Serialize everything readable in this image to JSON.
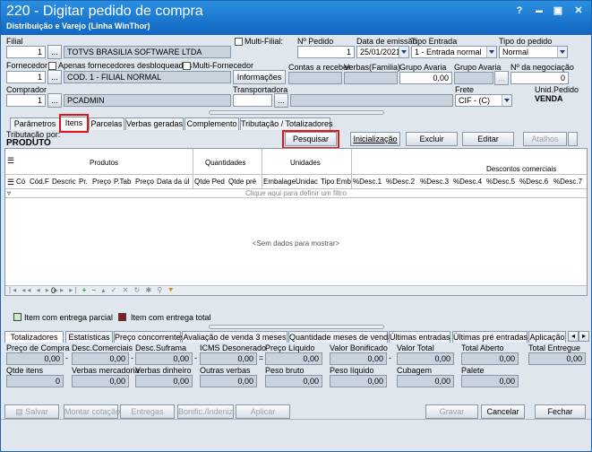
{
  "window": {
    "title": "220 - Digitar pedido de compra",
    "subtitle": "Distribuição e Varejo (Linha WinThor)",
    "help": "?",
    "minimize": "▬",
    "maximize": "▣",
    "close": "✕"
  },
  "header": {
    "filial_label": "Filial",
    "filial_value": "1",
    "filial_name": "TOTVS BRASILIA SOFTWARE LTDA",
    "multi_filial_label": "Multi-Filial:",
    "numero_pedido_label": "Nº Pedido",
    "numero_pedido_value": "1",
    "data_emissao_label": "Data de emissão",
    "data_emissao_value": "25/01/2021",
    "tipo_entrada_label": "Tipo Entrada",
    "tipo_entrada_value": "1 - Entrada normal",
    "tipo_pedido_label": "Tipo do pedido",
    "tipo_pedido_value": "Normal",
    "fornecedor_label": "Fornecedor",
    "apenas_desbloqueados_label": "Apenas fornecedores desbloqueados",
    "multi_fornecedor_label": "Multi-Fornecedor",
    "fornecedor_value": "1",
    "fornecedor_name": "COD. 1 - FILIAL NORMAL",
    "informacoes_button": "Informações",
    "contas_receber_label": "Contas a receber",
    "verbas_familia_label": "Verbas(Familia)",
    "grupo_avaria_label": "Grupo Avaria",
    "grupo_avaria_value": "0,00",
    "grupo_avaria2_label": "Grupo Avaria",
    "numero_negociacao_label": "Nº da negociação",
    "numero_negociacao_value": "0",
    "comprador_label": "Comprador",
    "comprador_value": "1",
    "comprador_name": "PCADMIN",
    "transportadora_label": "Transportadora",
    "frete_label": "Frete",
    "frete_value": "CIF - (C)",
    "unid_pedido_label": "Unid.Pedido",
    "unid_pedido_value": "VENDA",
    "ellipsis": "..."
  },
  "tabs": [
    "Parâmetros",
    "Itens",
    "Parcelas",
    "Verbas geradas",
    "Complemento",
    "Tributação / Totalizadores"
  ],
  "itens": {
    "tributacao_label": "Tributação por:",
    "tributacao_value": "PRODUTO",
    "pesquisar": "Pesquisar",
    "inicializacao": "Inicialização",
    "excluir": "Excluir",
    "editar": "Editar",
    "atalhos": "Atalhos"
  },
  "grid": {
    "group_produtos": "Produtos",
    "group_quantidades": "Quantidades",
    "group_unidades": "Unidades",
    "group_descontos": "Descontos comerciais",
    "columns": [
      "Có",
      "Cód.F",
      "Descric",
      "Pr.",
      "Preço",
      "P.Tab",
      "Preço",
      "Data da úl",
      "Qtde Ped",
      "Qtde pré",
      "Embalage",
      "Unidac",
      "Tipo Emb",
      "%Desc.1",
      "%Desc.2",
      "%Desc.3",
      "%Desc.4",
      "%Desc.5",
      "%Desc.6",
      "%Desc.7"
    ],
    "filter_hint": "Clique aqui para definir um filtro",
    "empty": "<Sem dados para mostrar>",
    "footer_count": "0"
  },
  "legend": {
    "parcial": "Item com entrega parcial",
    "total": "Item com entrega total",
    "parcial_color": "#c9ecc8",
    "total_color": "#8b1a1a"
  },
  "bottom_tabs": [
    "Totalizadores",
    "Estatísticas",
    "Preço concorrentes",
    "Avaliação de venda 3 meses",
    "Quantidade meses de venda",
    "Últimas entradas",
    "Últimas pré entradas",
    "Aplicação"
  ],
  "totals": {
    "preco_compra_label": "Preço de Compra",
    "preco_compra": "0,00",
    "desc_comerciais_label": "Desc.Comerciais",
    "desc_comerciais": "0,00",
    "desc_suframa_label": "Desc.Suframa",
    "desc_suframa": "0,00",
    "icms_label": "ICMS Desonerado",
    "icms": "0,00",
    "preco_liquido_label": "Preço Líquido",
    "preco_liquido": "0,00",
    "valor_bonificado_label": "Valor Bonificado",
    "valor_bonificado": "0,00",
    "valor_total_label": "Valor Total",
    "valor_total": "0,00",
    "total_aberto_label": "Total Aberto",
    "total_aberto": "0,00",
    "total_entregue_label": "Total Entregue",
    "total_entregue": "0,00",
    "qtde_itens_label": "Qtde itens",
    "qtde_itens": "0",
    "verbas_mercadoria_label": "Verbas mercadoria",
    "verbas_mercadoria": "0,00",
    "verbas_dinheiro_label": "Verbas dinheiro",
    "verbas_dinheiro": "0,00",
    "outras_verbas_label": "Outras verbas",
    "outras_verbas": "0,00",
    "peso_bruto_label": "Peso bruto",
    "peso_bruto": "0,00",
    "peso_liquido_label": "Peso líquido",
    "peso_liquido": "0,00",
    "cubagem_label": "Cubagem",
    "cubagem": "0,00",
    "palete_label": "Palete",
    "palete": "0,00",
    "minus": "-",
    "equals": "="
  },
  "footer": {
    "salvar": "Salvar",
    "montar_cotacao": "Montar cotação",
    "entregas": "Entregas",
    "bonific": "Bonific./Indeniz.",
    "aplicar": "Aplicar",
    "gravar": "Gravar",
    "cancelar": "Cancelar",
    "fechar": "Fechar"
  }
}
